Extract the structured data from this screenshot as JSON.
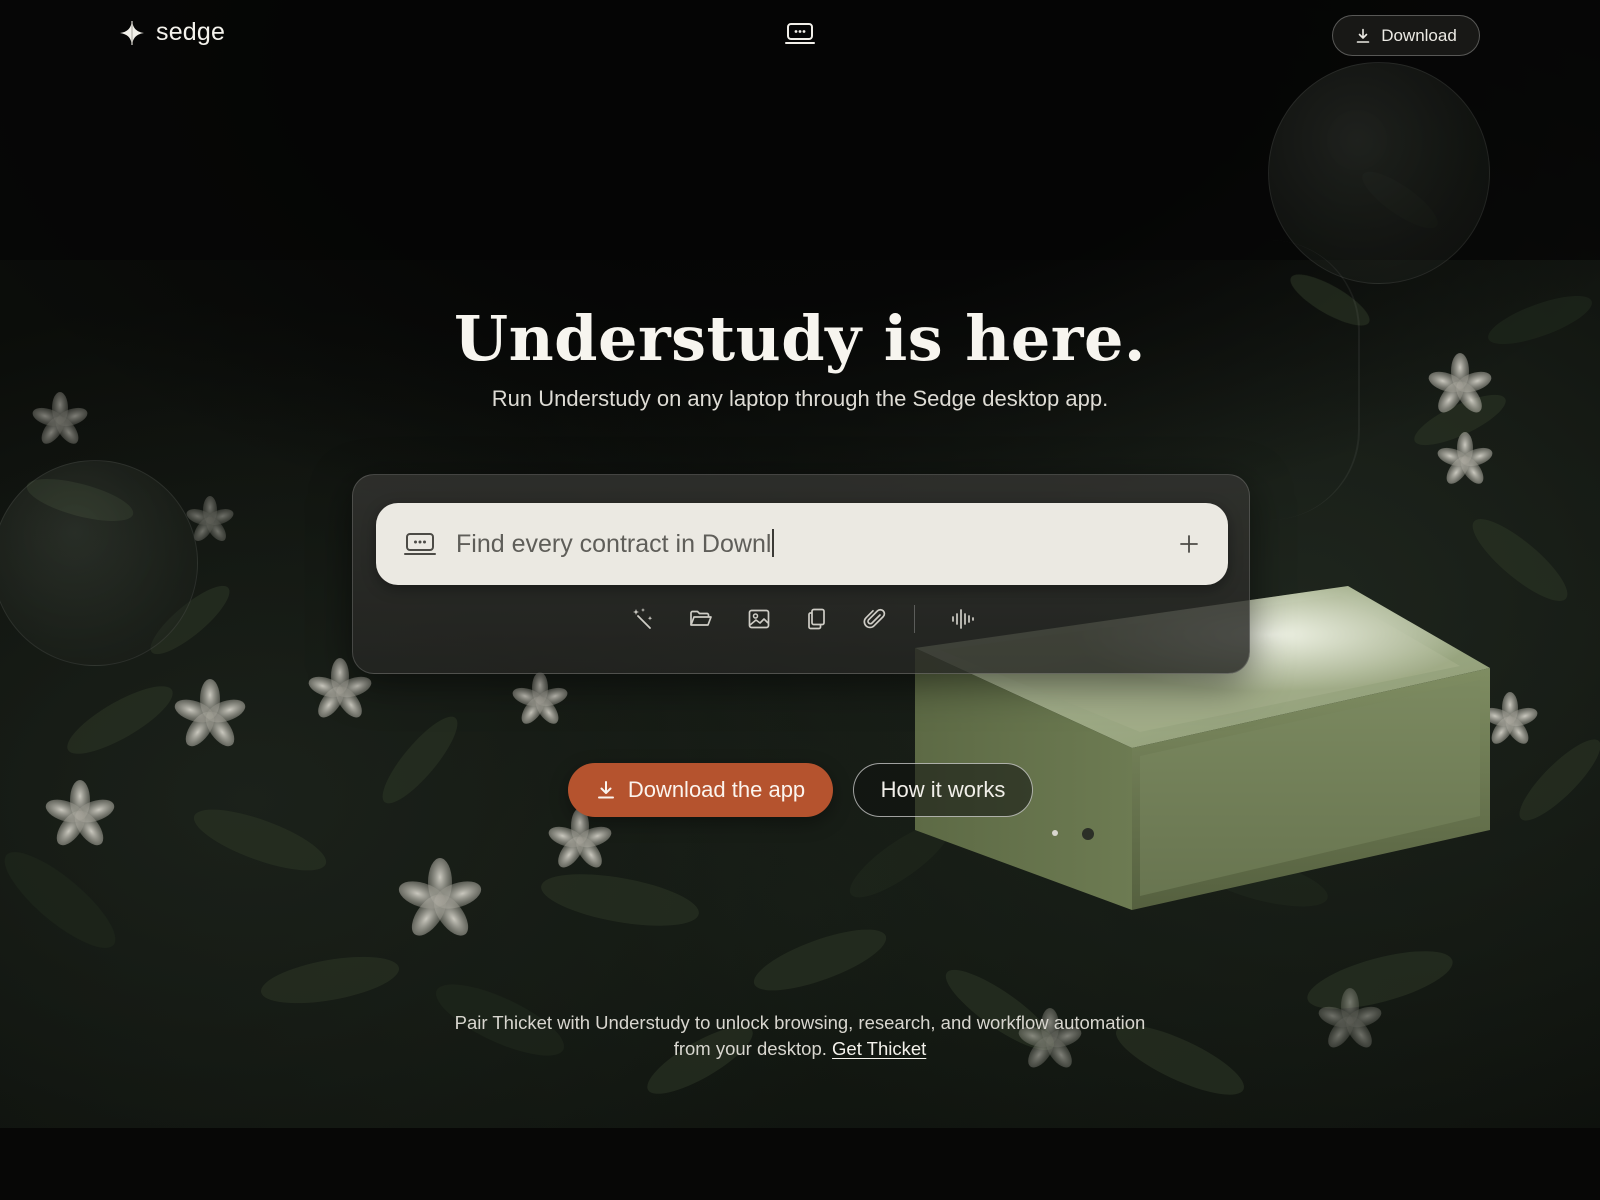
{
  "brand": {
    "name": "sedge"
  },
  "header": {
    "download_label": "Download"
  },
  "hero": {
    "title": "Understudy is here.",
    "subtitle": "Run Understudy on any laptop through the Sedge desktop app."
  },
  "prompt": {
    "typed_text": "Find every contract in Downl",
    "tools": [
      "magic-wand-icon",
      "folder-open-icon",
      "image-icon",
      "copy-document-icon",
      "paperclip-icon",
      "voice-waveform-icon"
    ]
  },
  "cta": {
    "primary_label": "Download the app",
    "secondary_label": "How it works"
  },
  "carousel": {
    "count": 2,
    "active_index": 1
  },
  "footer": {
    "line1": "Pair Thicket with Understudy to unlock browsing, research, and workflow automation",
    "line2_prefix": "from your desktop.",
    "link_label": "Get Thicket"
  },
  "colors": {
    "accent": "#b5532e",
    "prompt_bg": "#ebe9e2",
    "box_green": "#7f8d62"
  }
}
